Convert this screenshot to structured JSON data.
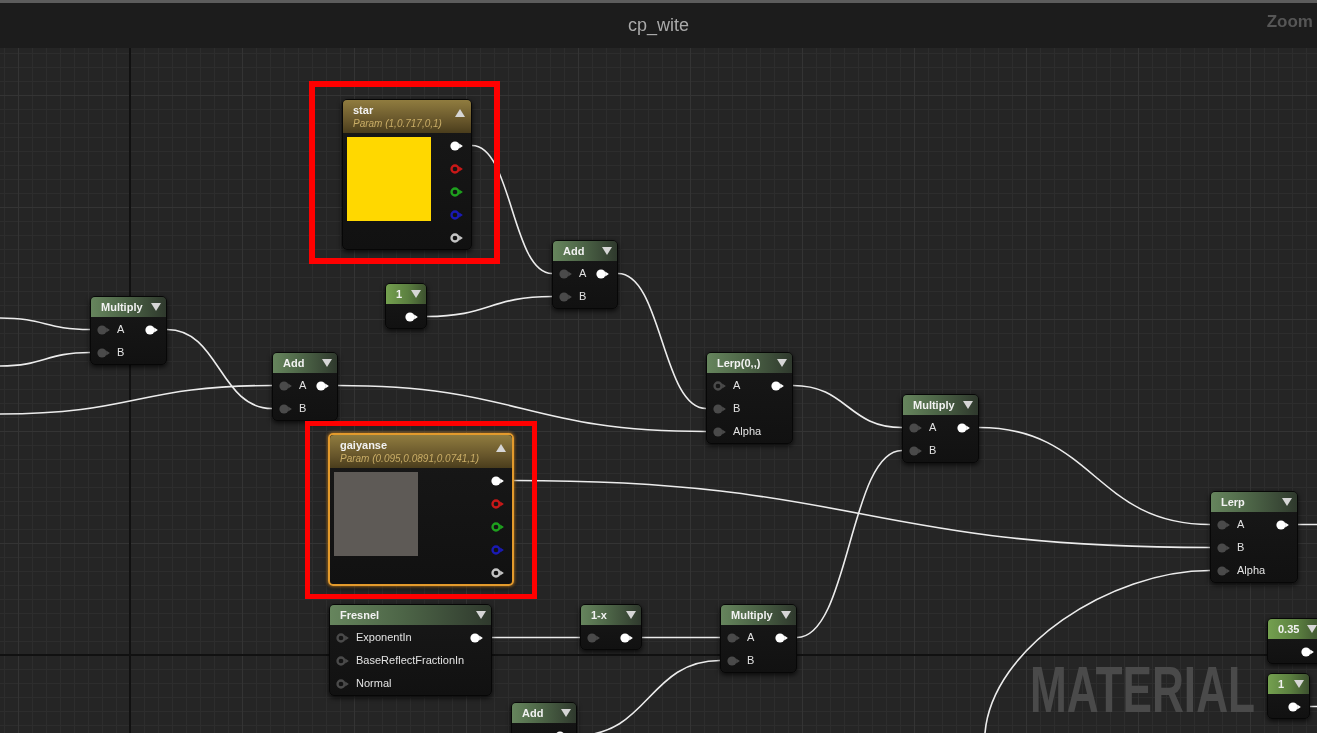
{
  "window": {
    "title": "cp_wite",
    "zoom_label": "Zoom"
  },
  "graph": {
    "watermark": "MATERIAL"
  },
  "nodes": [
    {
      "kind": "vector_param",
      "title": "star",
      "subtitle": "Param (1,0.717,0,1)",
      "swatch": {
        "color": "#ffd800"
      },
      "highlighted": true,
      "selected": false,
      "outputs": [
        {
          "color": "#ffffff",
          "connected": true
        },
        {
          "color": "#c81818",
          "connected": false
        },
        {
          "color": "#1ea01e",
          "connected": false
        },
        {
          "color": "#1a1ab4",
          "connected": false
        },
        {
          "color": "#c4c4c4",
          "connected": false
        }
      ]
    },
    {
      "kind": "math",
      "title": "Multiply",
      "highlighted": false,
      "selected": false,
      "inputs": [
        {
          "label": "A",
          "connected": true
        },
        {
          "label": "B",
          "connected": true
        }
      ],
      "outputs": [
        {
          "connected": true
        }
      ]
    },
    {
      "kind": "constant",
      "title": "1",
      "highlighted": false,
      "selected": false,
      "outputs": [
        {
          "connected": true
        }
      ]
    },
    {
      "kind": "math",
      "title": "Add",
      "highlighted": false,
      "selected": false,
      "inputs": [
        {
          "label": "A",
          "connected": true
        },
        {
          "label": "B",
          "connected": true
        }
      ],
      "outputs": [
        {
          "connected": true
        }
      ]
    },
    {
      "kind": "math",
      "title": "Add",
      "highlighted": false,
      "selected": false,
      "inputs": [
        {
          "label": "A",
          "connected": true
        },
        {
          "label": "B",
          "connected": true
        }
      ],
      "outputs": [
        {
          "connected": true
        }
      ]
    },
    {
      "kind": "vector_param",
      "title": "gaiyanse",
      "subtitle": "Param (0.095,0.0891,0.0741,1)",
      "swatch": {
        "color": "#5e5a56"
      },
      "highlighted": true,
      "selected": true,
      "outputs": [
        {
          "color": "#ffffff",
          "connected": true
        },
        {
          "color": "#c81818",
          "connected": false
        },
        {
          "color": "#1ea01e",
          "connected": false
        },
        {
          "color": "#1a1ab4",
          "connected": false
        },
        {
          "color": "#c4c4c4",
          "connected": false
        }
      ]
    },
    {
      "kind": "math",
      "title": "Lerp(0,,)",
      "highlighted": false,
      "selected": false,
      "inputs": [
        {
          "label": "A",
          "connected": false
        },
        {
          "label": "B",
          "connected": true
        },
        {
          "label": "Alpha",
          "connected": true
        }
      ],
      "outputs": [
        {
          "connected": true
        }
      ]
    },
    {
      "kind": "math",
      "title": "Multiply",
      "highlighted": false,
      "selected": false,
      "inputs": [
        {
          "label": "A",
          "connected": true
        },
        {
          "label": "B",
          "connected": true
        }
      ],
      "outputs": [
        {
          "connected": true
        }
      ]
    },
    {
      "kind": "math",
      "title": "Lerp",
      "highlighted": false,
      "selected": false,
      "inputs": [
        {
          "label": "A",
          "connected": true
        },
        {
          "label": "B",
          "connected": true
        },
        {
          "label": "Alpha",
          "connected": true
        }
      ],
      "outputs": [
        {
          "connected": true
        }
      ]
    },
    {
      "kind": "math",
      "title": "Fresnel",
      "highlighted": false,
      "selected": false,
      "inputs": [
        {
          "label": "ExponentIn",
          "connected": false
        },
        {
          "label": "BaseReflectFractionIn",
          "connected": false
        },
        {
          "label": "Normal",
          "connected": false
        }
      ],
      "outputs": [
        {
          "connected": true
        }
      ]
    },
    {
      "kind": "math",
      "title": "1-x",
      "highlighted": false,
      "selected": false,
      "inputs": [
        {
          "connected": true
        }
      ],
      "outputs": [
        {
          "connected": true
        }
      ]
    },
    {
      "kind": "math",
      "title": "Multiply",
      "highlighted": false,
      "selected": false,
      "inputs": [
        {
          "label": "A",
          "connected": true
        },
        {
          "label": "B",
          "connected": true
        }
      ],
      "outputs": [
        {
          "connected": true
        }
      ]
    },
    {
      "kind": "math",
      "title": "Add",
      "highlighted": false,
      "selected": false,
      "outputs": [
        {
          "connected": true
        }
      ]
    },
    {
      "kind": "constant",
      "title": "0.35",
      "highlighted": false,
      "selected": false,
      "outputs": [
        {
          "connected": true
        }
      ]
    },
    {
      "kind": "constant",
      "title": "1",
      "highlighted": false,
      "selected": false,
      "outputs": [
        {
          "connected": true
        }
      ]
    }
  ]
}
